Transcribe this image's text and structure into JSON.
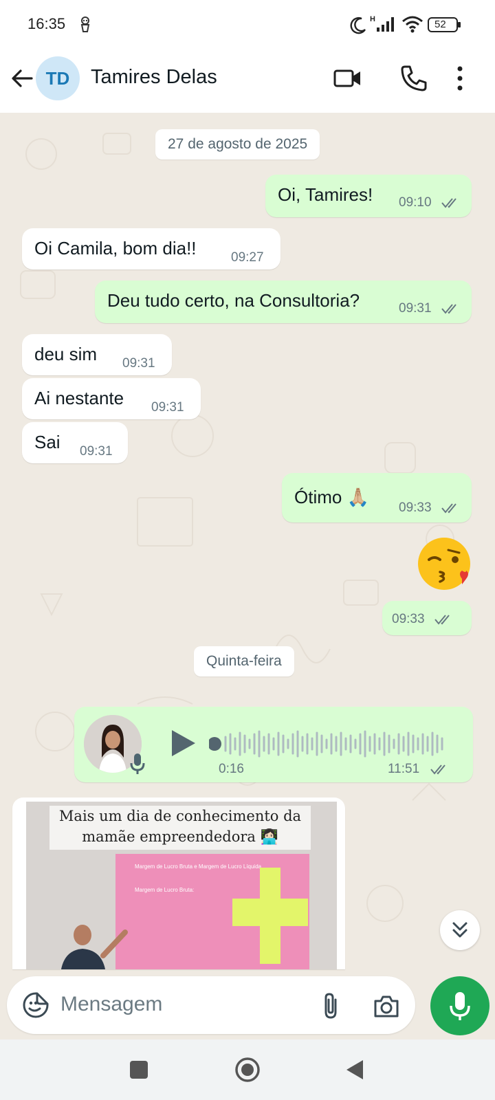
{
  "status_bar": {
    "time": "16:35",
    "battery": "52",
    "icons": [
      "incognito-icon",
      "moon-icon",
      "signal-icon",
      "wifi-icon",
      "battery-icon"
    ]
  },
  "header": {
    "avatar_initials": "TD",
    "contact_name": "Tamires Delas",
    "icons": [
      "back-arrow-icon",
      "video-call-icon",
      "voice-call-icon",
      "more-options-icon"
    ]
  },
  "chat": {
    "date_chip": "27 de agosto de 2025",
    "messages": [
      {
        "text": "Oi, Tamires!",
        "time": "09:10",
        "direction": "out"
      },
      {
        "text": "Oi Camila, bom dia!!",
        "time": "09:27",
        "direction": "in"
      },
      {
        "text": "Deu tudo certo, na Consultoria?",
        "time": "09:31",
        "direction": "out"
      },
      {
        "text": "deu sim",
        "time": "09:31",
        "direction": "in"
      },
      {
        "text": "Ai nestante",
        "time": "09:31",
        "direction": "in"
      },
      {
        "text": "Sai",
        "time": "09:31",
        "direction": "in"
      },
      {
        "text": "Ótimo 🙏🏼",
        "time": "09:33",
        "direction": "out"
      },
      {
        "text": "😘",
        "time": "09:33",
        "direction": "out"
      }
    ],
    "day_chip": "Quinta-feira",
    "voice_message": {
      "duration": "0:16",
      "time": "11:51"
    },
    "image_message": {
      "caption": "Mais um dia de conhecimento da mamãe empreendedora 👩🏻‍💻",
      "slide_title": "Margem de Lucro Bruta e Margem de Lucro Líquida",
      "slide_subtitle": "Margem de Lucro Bruta:"
    }
  },
  "composer": {
    "placeholder": "Mensagem",
    "icons": [
      "sticker-icon",
      "attach-icon",
      "camera-icon",
      "mic-icon"
    ]
  },
  "colors": {
    "outgoing_bubble": "#d9fdd3",
    "incoming_bubble": "#ffffff",
    "chat_background": "#efeae2",
    "accent_green": "#1fa855",
    "read_ticks": "#667781"
  }
}
